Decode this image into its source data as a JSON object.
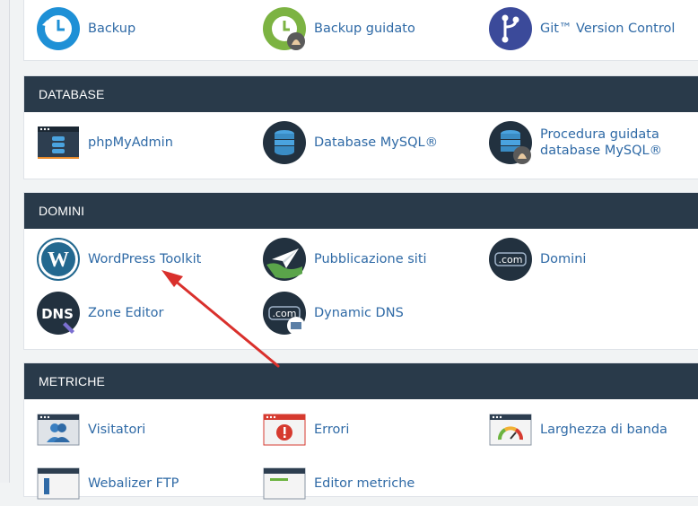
{
  "sections": {
    "top": {
      "items": [
        {
          "label": "Backup",
          "icon": "backup-clock-icon"
        },
        {
          "label": "Backup guidato",
          "icon": "backup-wizard-icon"
        },
        {
          "label": "Git™ Version Control",
          "icon": "git-branch-icon"
        }
      ]
    },
    "database": {
      "title": "DATABASE",
      "items": [
        {
          "label": "phpMyAdmin",
          "icon": "phpmyadmin-icon"
        },
        {
          "label": "Database MySQL®",
          "icon": "mysql-database-icon"
        },
        {
          "label": "Procedura guidata database MySQL®",
          "icon": "mysql-wizard-icon"
        }
      ]
    },
    "domini": {
      "title": "DOMINI",
      "items": [
        {
          "label": "WordPress Toolkit",
          "icon": "wordpress-icon"
        },
        {
          "label": "Pubblicazione siti",
          "icon": "site-publisher-icon"
        },
        {
          "label": "Domini",
          "icon": "domains-com-icon"
        },
        {
          "label": "Zone Editor",
          "icon": "dns-zone-icon"
        },
        {
          "label": "Dynamic DNS",
          "icon": "dynamic-dns-icon"
        }
      ]
    },
    "metriche": {
      "title": "METRICHE",
      "items": [
        {
          "label": "Visitatori",
          "icon": "visitors-icon"
        },
        {
          "label": "Errori",
          "icon": "errors-icon"
        },
        {
          "label": "Larghezza di banda",
          "icon": "bandwidth-gauge-icon"
        },
        {
          "label": "Webalizer FTP",
          "icon": "webalizer-icon"
        },
        {
          "label": "Editor metriche",
          "icon": "metrics-editor-icon"
        }
      ]
    }
  },
  "colors": {
    "header_bg": "#293a4a",
    "link": "#2f6aa6",
    "arrow": "#d9302c"
  }
}
